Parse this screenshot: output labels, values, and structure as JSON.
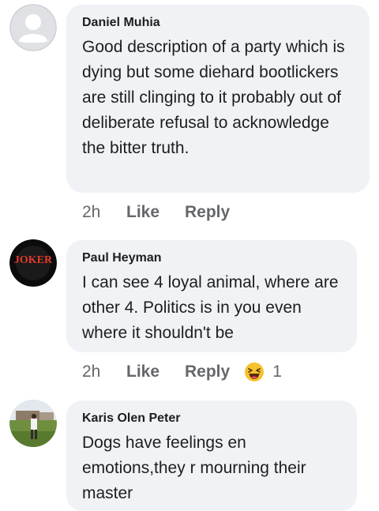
{
  "comments": [
    {
      "author": "Daniel Muhia",
      "text": "Good description of a party which is dying but some diehard bootlickers are still clinging to it probably out of deliberate refusal to acknowledge the bitter truth.",
      "time": "2h",
      "like_label": "Like",
      "reply_label": "Reply",
      "avatar": "default-avatar-icon"
    },
    {
      "author": "Paul Heyman",
      "text": "I can see 4 loyal animal, where are other 4. Politics is in you even where it shouldn't be",
      "time": "2h",
      "like_label": "Like",
      "reply_label": "Reply",
      "avatar": "joker-avatar",
      "avatar_text": "JOKER",
      "reaction_icon": "laughing-emoji-icon",
      "reaction_count": "1"
    },
    {
      "author": "Karis Olen Peter",
      "text": "Dogs have feelings en emotions,they r mourning their master",
      "avatar": "photo-avatar"
    }
  ],
  "colors": {
    "bubble": "#f0f2f5",
    "text": "#1c1e21",
    "meta": "#65676b"
  }
}
